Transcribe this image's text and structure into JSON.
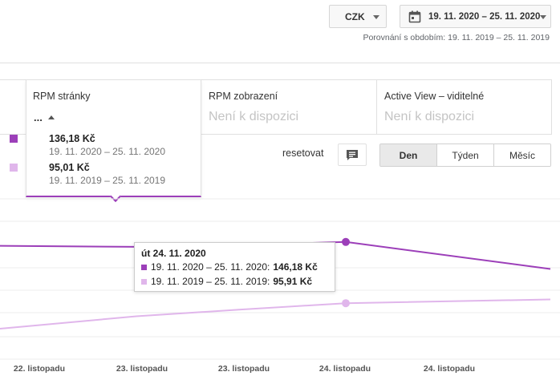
{
  "header": {
    "currency": "CZK",
    "date_range": "19. 11. 2020 – 25. 11. 2020",
    "comparison": "Porovnání s obdobím: 19. 11. 2019 – 25. 11. 2019"
  },
  "metrics": {
    "rpm_page": {
      "title": "RPM stránky",
      "headline": "...",
      "current_value": "136,18 Kč",
      "current_range": "19. 11. 2020 – 25. 11. 2020",
      "previous_value": "95,01 Kč",
      "previous_range": "19. 11. 2019 – 25. 11. 2019"
    },
    "rpm_impressions": {
      "title": "RPM zobrazení",
      "value": "Není k dispozici"
    },
    "active_view": {
      "title": "Active View – viditelné",
      "value": "Není k dispozici"
    }
  },
  "controls": {
    "reset_label": "resetovat",
    "granularity": [
      {
        "label": "Den",
        "active": true
      },
      {
        "label": "Týden",
        "active": false
      },
      {
        "label": "Měsíc",
        "active": false
      }
    ]
  },
  "colors": {
    "current_series": "#9c3fb9",
    "previous_series": "#e0b6eb",
    "grid": "#ececec"
  },
  "chart_data": {
    "type": "line",
    "title": "",
    "xlabel": "",
    "ylabel": "",
    "x_ticks": [
      "22. listopadu",
      "23. listopadu",
      "23. listopadu",
      "24. listopadu",
      "24. listopadu"
    ],
    "x": [
      0,
      1,
      2,
      3,
      4
    ],
    "series": [
      {
        "name": "19. 11. 2020 – 25. 11. 2020",
        "values": [
          143.0,
          142.2,
          143.7,
          146.18,
          124.0
        ]
      },
      {
        "name": "19. 11. 2019 – 25. 11. 2019",
        "values": [
          75.0,
          85.2,
          90.6,
          95.91,
          99.0
        ]
      }
    ],
    "highlight_index": 3,
    "ylim": [
      50,
      200
    ],
    "grid": true,
    "tooltip": {
      "date": "út 24. 11. 2020",
      "rows": [
        {
          "label": "19. 11. 2020 – 25. 11. 2020:",
          "value": "146,18 Kč"
        },
        {
          "label": "19. 11. 2019 – 25. 11. 2019:",
          "value": "95,91 Kč"
        }
      ]
    }
  }
}
